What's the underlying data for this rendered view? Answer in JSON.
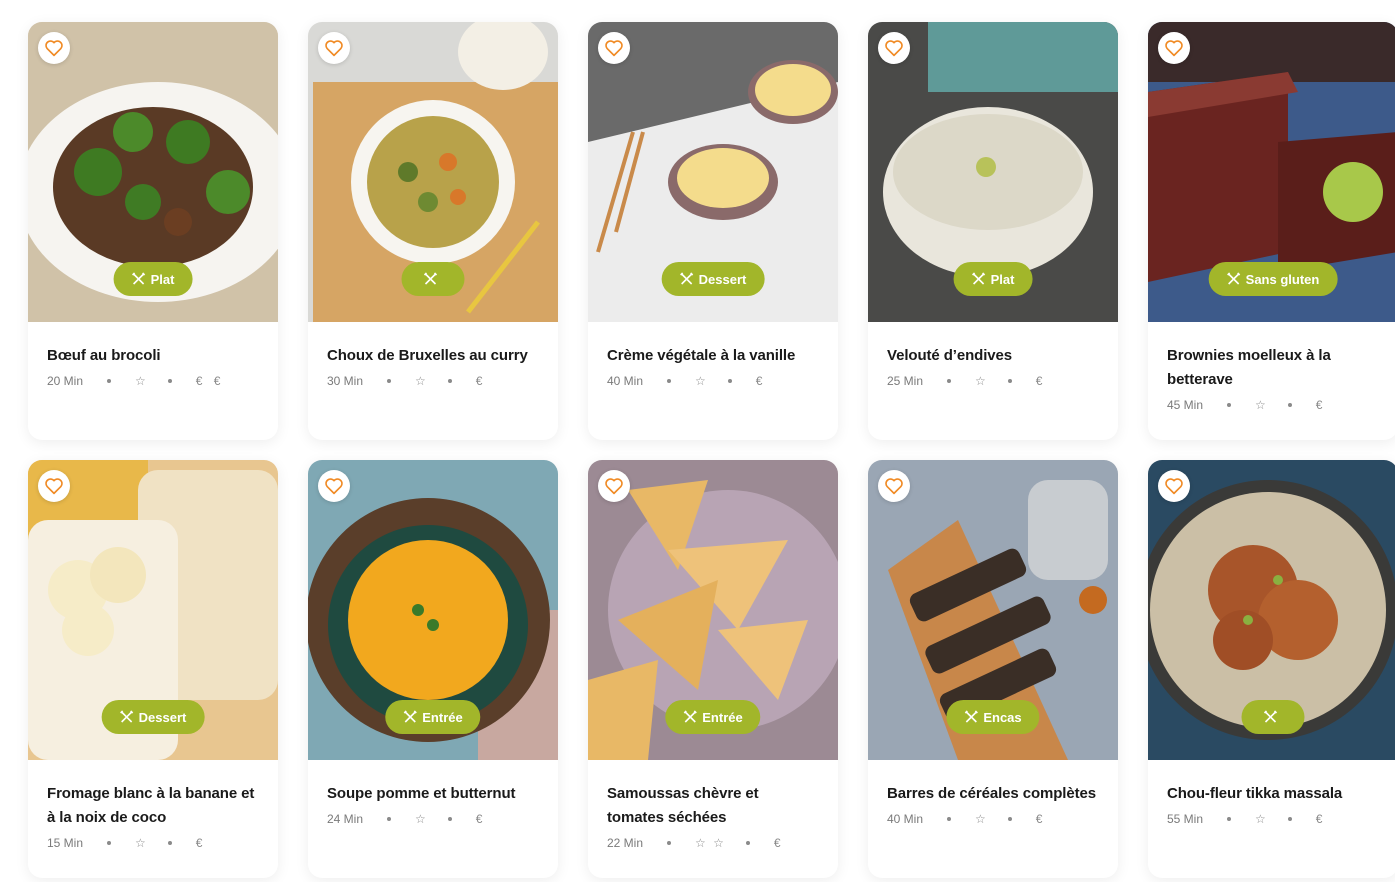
{
  "colors": {
    "accent": "#a2b62a",
    "heart": "#f08a24"
  },
  "recipes": [
    {
      "title": "Bœuf au brocoli",
      "time": "20 Min",
      "difficulty": "☆",
      "cost": "€ €",
      "category": "Plat"
    },
    {
      "title": "Choux de Bruxelles au curry",
      "time": "30 Min",
      "difficulty": "☆",
      "cost": "€",
      "category": ""
    },
    {
      "title": "Crème végétale à la vanille",
      "time": "40 Min",
      "difficulty": "☆",
      "cost": "€",
      "category": "Dessert"
    },
    {
      "title": "Velouté d’endives",
      "time": "25 Min",
      "difficulty": "☆",
      "cost": "€",
      "category": "Plat"
    },
    {
      "title": "Brownies moelleux à la betterave",
      "time": "45 Min",
      "difficulty": "☆",
      "cost": "€",
      "category": "Sans gluten"
    },
    {
      "title": "Fromage blanc à la banane et à la noix de coco",
      "time": "15 Min",
      "difficulty": "☆",
      "cost": "€",
      "category": "Dessert"
    },
    {
      "title": "Soupe pomme et butternut",
      "time": "24 Min",
      "difficulty": "☆",
      "cost": "€",
      "category": "Entrée"
    },
    {
      "title": "Samoussas chèvre et tomates séchées",
      "time": "22 Min",
      "difficulty": "☆ ☆",
      "cost": "€",
      "category": "Entrée"
    },
    {
      "title": "Barres de céréales complètes",
      "time": "40 Min",
      "difficulty": "☆",
      "cost": "€",
      "category": "Encas"
    },
    {
      "title": "Chou-fleur tikka massala",
      "time": "55 Min",
      "difficulty": "☆",
      "cost": "€",
      "category": ""
    }
  ]
}
